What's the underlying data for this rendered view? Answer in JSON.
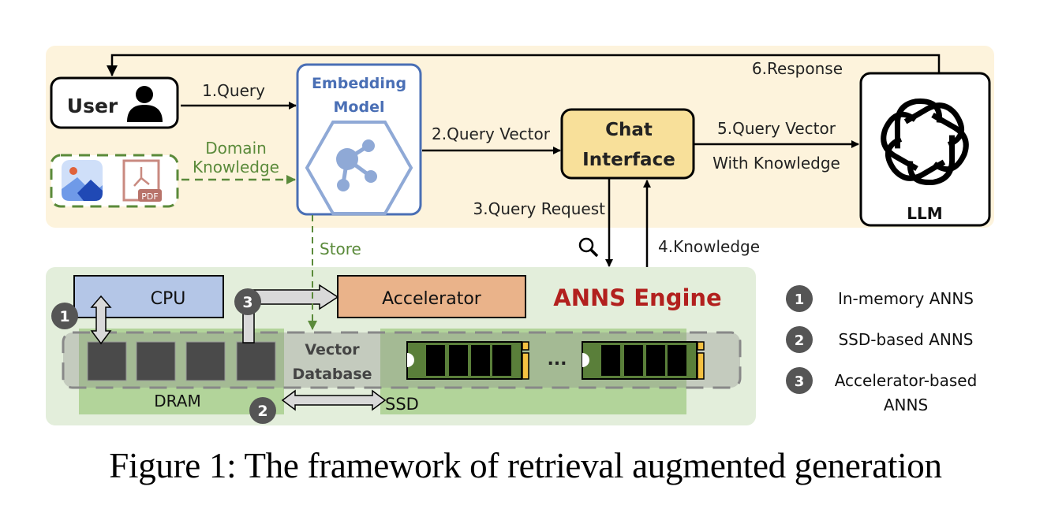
{
  "figure": {
    "caption": "Figure 1: The framework of retrieval augmented generation",
    "top_panel": {
      "user": {
        "label": "User",
        "icon": "person-icon"
      },
      "embedding_model": {
        "title_line1": "Embedding",
        "title_line2": "Model",
        "icon": "share-network-hexagon-icon"
      },
      "chat_interface": {
        "line1": "Chat",
        "line2": "Interface"
      },
      "llm": {
        "label": "LLM",
        "icon": "openai-logo-icon"
      },
      "domain_sources": {
        "icons": [
          "image-icon",
          "pdf-icon"
        ],
        "pdf_badge": "PDF"
      }
    },
    "edges": {
      "query": "1.Query",
      "domain_line1": "Domain",
      "domain_line2": "Knowledge",
      "query_vector": "2.Query Vector",
      "query_request": "3.Query Request",
      "knowledge": "4.Knowledge",
      "query_vector_k_line1": "5.Query Vector",
      "query_vector_k_line2": "With Knowledge",
      "response": "6.Response",
      "store": "Store"
    },
    "anns_engine": {
      "title": "ANNS Engine",
      "cpu": "CPU",
      "accelerator": "Accelerator",
      "vector_db_line1": "Vector",
      "vector_db_line2": "Database",
      "dram": "DRAM",
      "ssd": "SSD",
      "ellipsis": "...",
      "badges": [
        "1",
        "2",
        "3"
      ]
    },
    "legend": [
      {
        "num": "1",
        "line1": "In-memory ANNS",
        "line2": ""
      },
      {
        "num": "2",
        "line1": "SSD-based ANNS",
        "line2": ""
      },
      {
        "num": "3",
        "line1": "Accelerator-based",
        "line2": "ANNS"
      }
    ],
    "colors": {
      "top_panel_bg": "#fdf3dc",
      "bottom_panel_bg": "#e3eedb",
      "embedding_blue": "#4a6fb5",
      "hex_blue": "#8fa9d6",
      "chat_fill": "#f8e09a",
      "cpu_fill": "#b4c6e7",
      "accel_fill": "#eab38a",
      "anns_red": "#b2201e",
      "green_text": "#5a8a3a",
      "dram_green": "#a9cf8e",
      "ssd_stick": "#5a7f3a",
      "ssd_gold": "#f4c142",
      "badge_gray": "#555555",
      "vector_db_gray": "#9a9a9a"
    }
  }
}
